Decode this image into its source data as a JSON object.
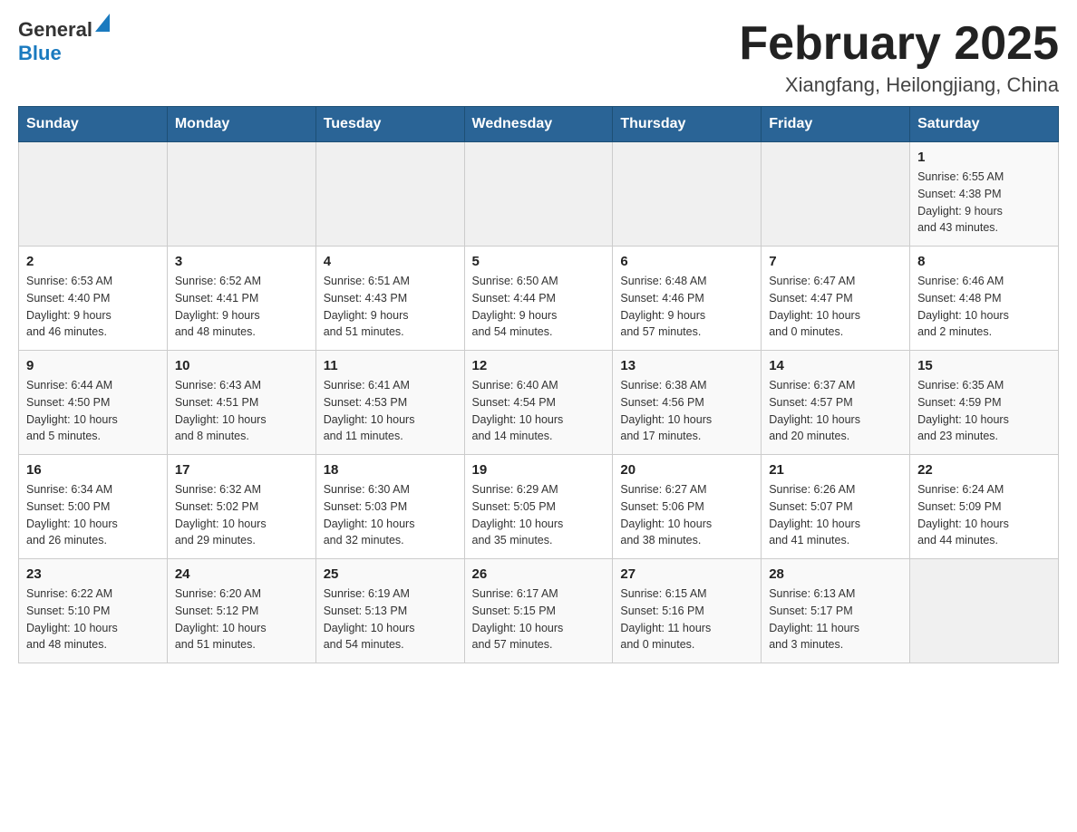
{
  "header": {
    "logo_general": "General",
    "logo_blue": "Blue",
    "month_title": "February 2025",
    "location": "Xiangfang, Heilongjiang, China"
  },
  "weekdays": [
    "Sunday",
    "Monday",
    "Tuesday",
    "Wednesday",
    "Thursday",
    "Friday",
    "Saturday"
  ],
  "weeks": [
    [
      {
        "day": "",
        "info": ""
      },
      {
        "day": "",
        "info": ""
      },
      {
        "day": "",
        "info": ""
      },
      {
        "day": "",
        "info": ""
      },
      {
        "day": "",
        "info": ""
      },
      {
        "day": "",
        "info": ""
      },
      {
        "day": "1",
        "info": "Sunrise: 6:55 AM\nSunset: 4:38 PM\nDaylight: 9 hours\nand 43 minutes."
      }
    ],
    [
      {
        "day": "2",
        "info": "Sunrise: 6:53 AM\nSunset: 4:40 PM\nDaylight: 9 hours\nand 46 minutes."
      },
      {
        "day": "3",
        "info": "Sunrise: 6:52 AM\nSunset: 4:41 PM\nDaylight: 9 hours\nand 48 minutes."
      },
      {
        "day": "4",
        "info": "Sunrise: 6:51 AM\nSunset: 4:43 PM\nDaylight: 9 hours\nand 51 minutes."
      },
      {
        "day": "5",
        "info": "Sunrise: 6:50 AM\nSunset: 4:44 PM\nDaylight: 9 hours\nand 54 minutes."
      },
      {
        "day": "6",
        "info": "Sunrise: 6:48 AM\nSunset: 4:46 PM\nDaylight: 9 hours\nand 57 minutes."
      },
      {
        "day": "7",
        "info": "Sunrise: 6:47 AM\nSunset: 4:47 PM\nDaylight: 10 hours\nand 0 minutes."
      },
      {
        "day": "8",
        "info": "Sunrise: 6:46 AM\nSunset: 4:48 PM\nDaylight: 10 hours\nand 2 minutes."
      }
    ],
    [
      {
        "day": "9",
        "info": "Sunrise: 6:44 AM\nSunset: 4:50 PM\nDaylight: 10 hours\nand 5 minutes."
      },
      {
        "day": "10",
        "info": "Sunrise: 6:43 AM\nSunset: 4:51 PM\nDaylight: 10 hours\nand 8 minutes."
      },
      {
        "day": "11",
        "info": "Sunrise: 6:41 AM\nSunset: 4:53 PM\nDaylight: 10 hours\nand 11 minutes."
      },
      {
        "day": "12",
        "info": "Sunrise: 6:40 AM\nSunset: 4:54 PM\nDaylight: 10 hours\nand 14 minutes."
      },
      {
        "day": "13",
        "info": "Sunrise: 6:38 AM\nSunset: 4:56 PM\nDaylight: 10 hours\nand 17 minutes."
      },
      {
        "day": "14",
        "info": "Sunrise: 6:37 AM\nSunset: 4:57 PM\nDaylight: 10 hours\nand 20 minutes."
      },
      {
        "day": "15",
        "info": "Sunrise: 6:35 AM\nSunset: 4:59 PM\nDaylight: 10 hours\nand 23 minutes."
      }
    ],
    [
      {
        "day": "16",
        "info": "Sunrise: 6:34 AM\nSunset: 5:00 PM\nDaylight: 10 hours\nand 26 minutes."
      },
      {
        "day": "17",
        "info": "Sunrise: 6:32 AM\nSunset: 5:02 PM\nDaylight: 10 hours\nand 29 minutes."
      },
      {
        "day": "18",
        "info": "Sunrise: 6:30 AM\nSunset: 5:03 PM\nDaylight: 10 hours\nand 32 minutes."
      },
      {
        "day": "19",
        "info": "Sunrise: 6:29 AM\nSunset: 5:05 PM\nDaylight: 10 hours\nand 35 minutes."
      },
      {
        "day": "20",
        "info": "Sunrise: 6:27 AM\nSunset: 5:06 PM\nDaylight: 10 hours\nand 38 minutes."
      },
      {
        "day": "21",
        "info": "Sunrise: 6:26 AM\nSunset: 5:07 PM\nDaylight: 10 hours\nand 41 minutes."
      },
      {
        "day": "22",
        "info": "Sunrise: 6:24 AM\nSunset: 5:09 PM\nDaylight: 10 hours\nand 44 minutes."
      }
    ],
    [
      {
        "day": "23",
        "info": "Sunrise: 6:22 AM\nSunset: 5:10 PM\nDaylight: 10 hours\nand 48 minutes."
      },
      {
        "day": "24",
        "info": "Sunrise: 6:20 AM\nSunset: 5:12 PM\nDaylight: 10 hours\nand 51 minutes."
      },
      {
        "day": "25",
        "info": "Sunrise: 6:19 AM\nSunset: 5:13 PM\nDaylight: 10 hours\nand 54 minutes."
      },
      {
        "day": "26",
        "info": "Sunrise: 6:17 AM\nSunset: 5:15 PM\nDaylight: 10 hours\nand 57 minutes."
      },
      {
        "day": "27",
        "info": "Sunrise: 6:15 AM\nSunset: 5:16 PM\nDaylight: 11 hours\nand 0 minutes."
      },
      {
        "day": "28",
        "info": "Sunrise: 6:13 AM\nSunset: 5:17 PM\nDaylight: 11 hours\nand 3 minutes."
      },
      {
        "day": "",
        "info": ""
      }
    ]
  ]
}
